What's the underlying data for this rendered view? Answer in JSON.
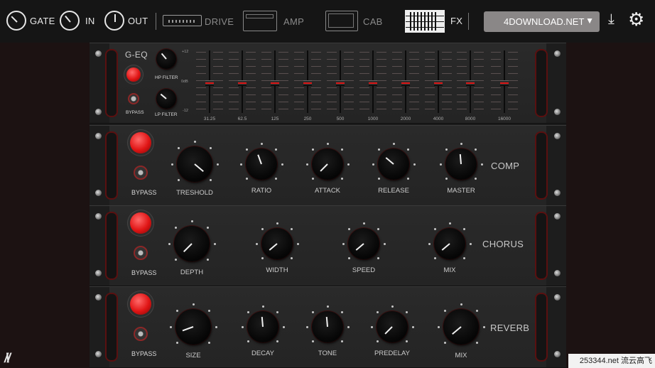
{
  "topbar": {
    "gate_label": "GATE",
    "in_label": "IN",
    "out_label": "OUT",
    "drive_label": "DRIVE",
    "amp_label": "AMP",
    "cab_label": "CAB",
    "fx_label": "FX",
    "preset_value": "4DOWNLOAD.NET",
    "preset_caret": "▼",
    "download_icon": "⤓",
    "settings_icon": "⚙"
  },
  "geq": {
    "title": "G-EQ",
    "hp_filter_label": "HP FILTER",
    "lp_filter_label": "LP FILTER",
    "bypass_label": "BYPASS",
    "db_top": "+12",
    "db_mid": "0dB",
    "db_bottom": "-12",
    "bands": [
      "31.25",
      "62.5",
      "125",
      "250",
      "500",
      "1000",
      "2000",
      "4000",
      "8000",
      "16000"
    ]
  },
  "comp": {
    "title": "COMP",
    "bypass_label": "BYPASS",
    "knobs": [
      "TRESHOLD",
      "RATIO",
      "ATTACK",
      "RELEASE",
      "MASTER"
    ]
  },
  "chorus": {
    "title": "CHORUS",
    "bypass_label": "BYPASS",
    "knobs": [
      "DEPTH",
      "WIDTH",
      "SPEED",
      "MIX"
    ]
  },
  "reverb": {
    "title": "REVERB",
    "bypass_label": "BYPASS",
    "knobs": [
      "SIZE",
      "DECAY",
      "TONE",
      "PREDELAY",
      "MIX"
    ]
  },
  "footer": {
    "logo": "/\\/",
    "watermark": "253344.net 流云高飞"
  },
  "colors": {
    "accent_red": "#e01515",
    "background": "#1c1212",
    "panel": "#262626"
  }
}
